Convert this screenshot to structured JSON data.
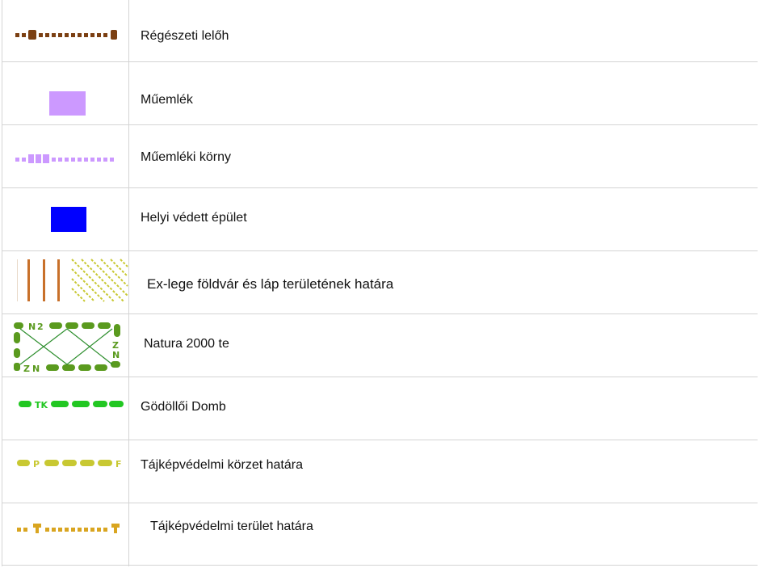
{
  "legend": {
    "items": [
      {
        "label": "Régészeti lelőh",
        "symbol": "dotted-line-brown",
        "color": "#7b3f12"
      },
      {
        "label": "Műemlék",
        "symbol": "filled-rect-lilac",
        "color": "#cc99ff"
      },
      {
        "label": "Műemléki körny",
        "symbol": "dotted-line-MK",
        "color": "#cc99ff"
      },
      {
        "label": "Helyi védett épület",
        "symbol": "filled-rect-blue",
        "color": "#0000ff"
      },
      {
        "label": "Ex-lege földvár és láp területének határa",
        "symbol": "hatch-pattern",
        "colors": [
          "#c8702a",
          "#c8c832"
        ]
      },
      {
        "label": "Natura 2000 te",
        "symbol": "n2-dashed-box",
        "color": "#5a9a1e"
      },
      {
        "label": "Gödöllői Domb",
        "symbol": "dashed-line-TK",
        "color": "#22c722"
      },
      {
        "label": "Tájképvédelmi körzet határa",
        "symbol": "dashed-line-P",
        "color": "#c8c832"
      },
      {
        "label": "Tájképvédelmi terület határa",
        "symbol": "dotted-line-T",
        "color": "#d9a520"
      }
    ]
  }
}
